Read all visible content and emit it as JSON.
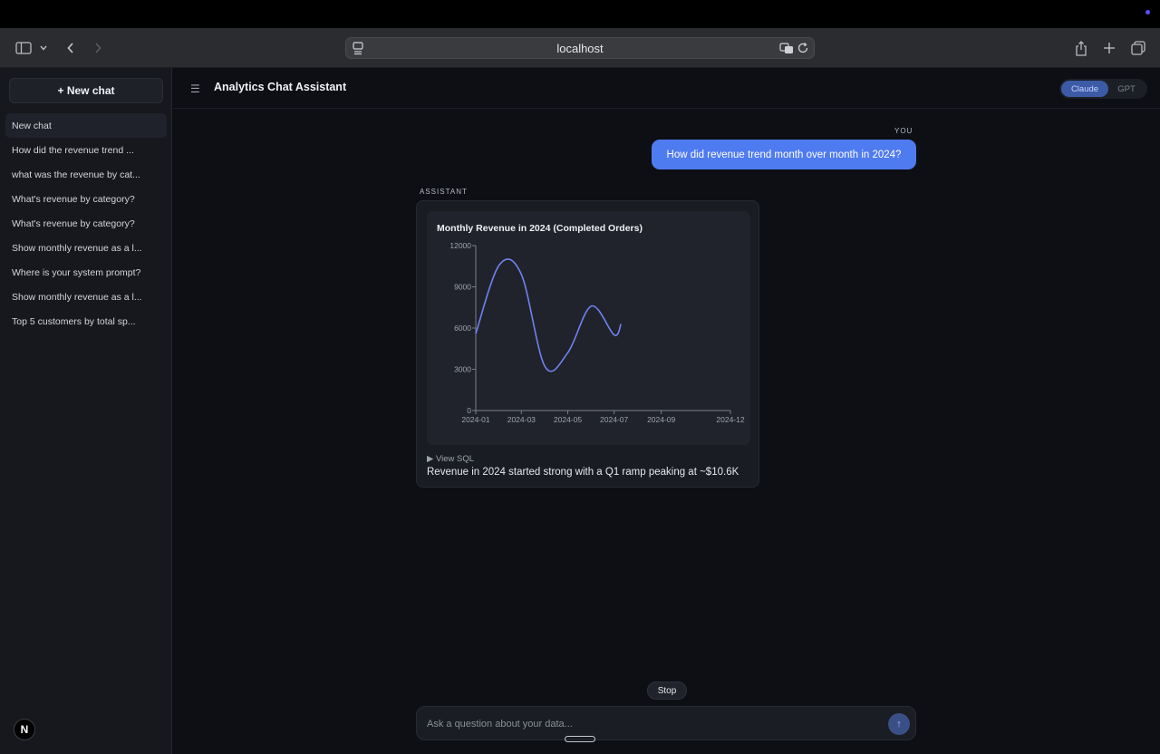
{
  "browser": {
    "url": "localhost"
  },
  "sidebar": {
    "new_chat_label": "+ New chat",
    "items": [
      {
        "label": "New chat"
      },
      {
        "label": "How did the revenue trend ..."
      },
      {
        "label": "what was the revenue by cat..."
      },
      {
        "label": "What's revenue by category?"
      },
      {
        "label": "What's revenue by category?"
      },
      {
        "label": "Show monthly revenue as a l..."
      },
      {
        "label": "Where is your system prompt?"
      },
      {
        "label": "Show monthly revenue as a l..."
      },
      {
        "label": "Top 5 customers by total sp..."
      }
    ],
    "logo_letter": "N"
  },
  "header": {
    "title": "Analytics Chat Assistant",
    "models": [
      "Claude",
      "GPT"
    ],
    "selected_model": "Claude"
  },
  "conversation": {
    "you_label": "YOU",
    "user_message": "How did revenue trend month over month in 2024?",
    "assistant_label": "ASSISTANT",
    "view_sql_label": "▶ View SQL",
    "answer_text": "Revenue in 2024 started strong with a Q1 ramp peaking at ~$10.6K"
  },
  "composer": {
    "stop_label": "Stop",
    "placeholder": "Ask a question about your data..."
  },
  "colors": {
    "accent": "#4f7bf0",
    "line": "#6f82f2"
  },
  "chart_data": {
    "type": "line",
    "title": "Monthly Revenue in 2024 (Completed Orders)",
    "xlabel": "",
    "ylabel": "",
    "x": [
      "2024-01-01",
      "2024-02-01",
      "2024-03-01",
      "2024-04-01",
      "2024-05-01",
      "2024-06-01",
      "2024-07-01",
      "2024-07-10"
    ],
    "values": [
      5600,
      10600,
      9900,
      3200,
      4200,
      7600,
      5500,
      6300
    ],
    "x_ticks": [
      "2024-01",
      "2024-03",
      "2024-05",
      "2024-07",
      "2024-09",
      "2024-12"
    ],
    "y_ticks": [
      0,
      3000,
      6000,
      9000,
      12000
    ],
    "ylim": [
      0,
      12000
    ],
    "xlim": [
      "2024-01-01",
      "2024-12-01"
    ],
    "grid": false
  }
}
